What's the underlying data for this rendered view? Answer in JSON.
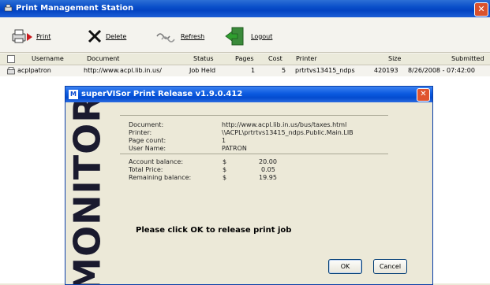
{
  "window": {
    "title": "Print Management Station",
    "close_glyph": "✕"
  },
  "toolbar": {
    "print_label": "Print",
    "delete_label": "Delete",
    "refresh_label": "Refresh",
    "logout_label": "Logout"
  },
  "list": {
    "headers": [
      "Username",
      "Document",
      "Status",
      "Pages",
      "Cost",
      "Printer",
      "Size",
      "Submitted"
    ],
    "rows": [
      [
        "acplpatron",
        "http://www.acpl.lib.in.us/",
        "Job Held",
        "1",
        "5",
        "prtrtvs13415_ndps",
        "420193",
        "8/26/2008 - 07:42:00"
      ]
    ]
  },
  "dialog": {
    "title": "superVISor Print Release v1.9.0.412",
    "brand": "MONITOR",
    "details": {
      "document_label": "Document:",
      "document_value": "http://www.acpl.lib.in.us/bus/taxes.html",
      "printer_label": "Printer:",
      "printer_value": "\\\\ACPL\\prtrtvs13415_ndps.Public.Main.LIB",
      "pagecount_label": "Page count:",
      "pagecount_value": "1",
      "username_label": "User Name:",
      "username_value": "PATRON"
    },
    "balance": {
      "account_label": "Account balance:",
      "account_currency": "$",
      "account_value": "20.00",
      "total_label": "Total Price:",
      "total_currency": "$",
      "total_value": "0.05",
      "remaining_label": "Remaining balance:",
      "remaining_currency": "$",
      "remaining_value": "19.95"
    },
    "message": "Please click OK to release print job",
    "ok_label": "OK",
    "cancel_label": "Cancel",
    "close_glyph": "✕",
    "logo_glyph": "M"
  },
  "colors": {
    "titlebar": "#0a4fc9",
    "dialog_titlebar": "#0b5ae0",
    "close_button": "#d9522e"
  }
}
